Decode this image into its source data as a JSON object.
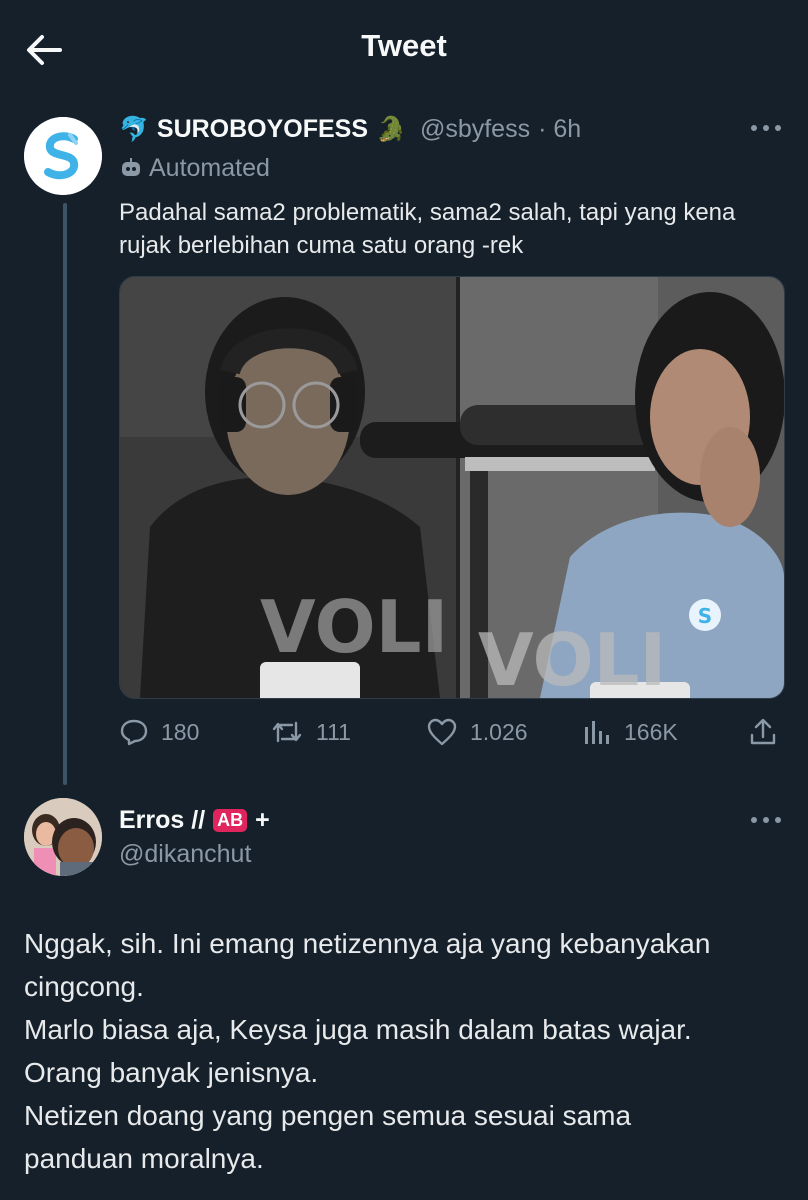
{
  "header": {
    "title": "Tweet"
  },
  "icons": {
    "back": "arrow-left-icon",
    "dolphin": "dolphin-icon",
    "crocodile": "crocodile-icon",
    "bot": "robot-icon",
    "more": "more-horizontal-icon",
    "reply": "reply-icon",
    "retweet": "retweet-icon",
    "like": "heart-icon",
    "views": "views-chart-icon",
    "share": "share-icon"
  },
  "tweet": {
    "display_name": "SUROBOYOFESS",
    "handle": "@sbyfess",
    "time": "· 6h",
    "automated_label": "Automated",
    "text": "Padahal sama2 problematik, sama2 salah, tapi yang kena rujak berlebihan cuma satu orang -rek",
    "media": {
      "left_caption": "VOLI",
      "right_caption": "VOLI"
    },
    "stats": {
      "replies": "180",
      "retweets": "111",
      "likes": "1.026",
      "views": "166K"
    }
  },
  "reply": {
    "display_name": "Erros //",
    "badge": "AB",
    "plus": "+",
    "handle": "@dikanchut",
    "text": "Nggak, sih. Ini emang netizennya aja yang kebanyakan\ncingcong.\nMarlo biasa aja, Keysa juga masih dalam batas wajar.\nOrang banyak jenisnya.\nNetizen doang yang pengen semua sesuai sama\npanduan moralnya."
  },
  "colors": {
    "background": "#15202b",
    "text": "#e7e9ea",
    "muted": "#8b98a5",
    "thread_line": "#3d5466",
    "accent_blue": "#1d9bf0"
  }
}
